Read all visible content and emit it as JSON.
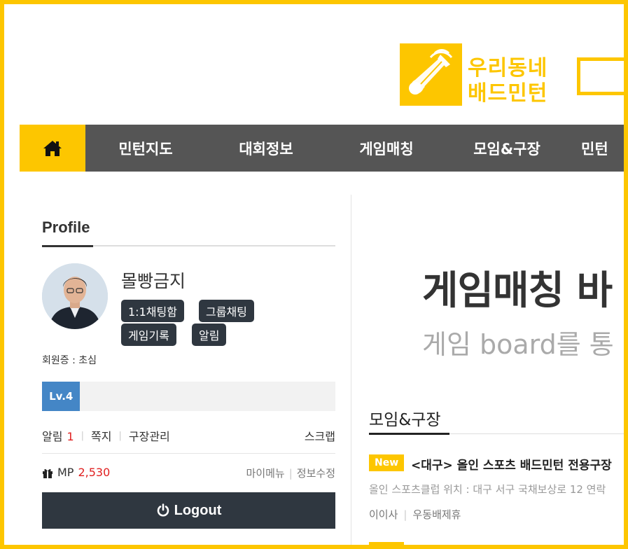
{
  "brand": {
    "name_line1": "우리동네",
    "name_line2": "배드민턴",
    "accent": "#fdc600",
    "nav_bg": "#555555"
  },
  "nav": {
    "home_icon": "home-icon",
    "items": [
      "민턴지도",
      "대회정보",
      "게임매칭",
      "모임&구장",
      "민턴"
    ]
  },
  "profile": {
    "heading": "Profile",
    "username": "몰빵금지",
    "buttons": [
      "1:1채팅함",
      "그룹채팅",
      "게임기록",
      "알림"
    ],
    "grade": "회원증 : 초심",
    "level_label": "Lv.4",
    "level_progress_pct": 13,
    "links": {
      "alarm": "알림",
      "alarm_count": "1",
      "note": "쪽지",
      "court": "구장관리",
      "scrap": "스크랩"
    },
    "mp_label": "MP",
    "mp_value": "2,530",
    "mymenu": "마이메뉴",
    "edit": "정보수정",
    "logout": "Logout"
  },
  "banner": {
    "title": "게임매칭 바",
    "subtitle": "게임 board를 통"
  },
  "section": {
    "title": "모임&구장",
    "post": {
      "badge": "New",
      "title": "<대구> 올인 스포츠 배드민턴 전용구장",
      "desc": "올인 스포츠클럽 위치 : 대구 서구 국채보상로 12 연락",
      "author": "이이사",
      "category": "우동배제휴"
    }
  }
}
